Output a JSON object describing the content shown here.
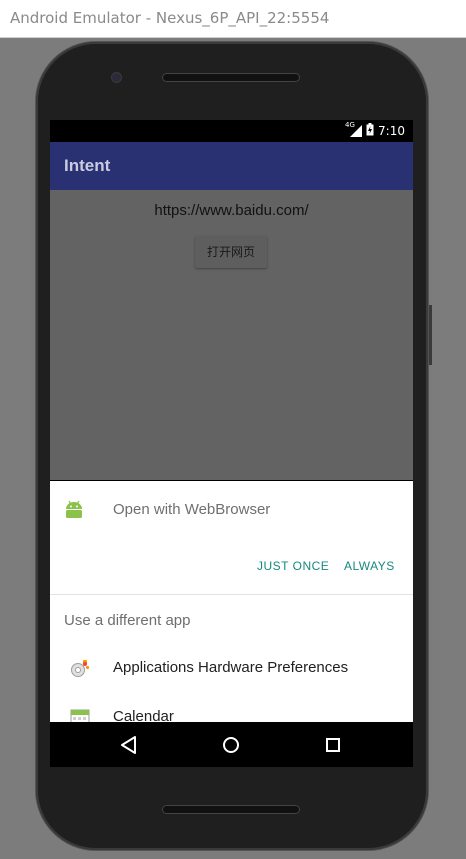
{
  "window": {
    "title": "Android Emulator - Nexus_6P_API_22:5554"
  },
  "status_bar": {
    "network": "4G",
    "time": "7:10"
  },
  "app_bar": {
    "title": "Intent"
  },
  "content": {
    "url": "https://www.baidu.com/",
    "button_label": "打开网页"
  },
  "chooser": {
    "open_with": "Open with WebBrowser",
    "just_once": "JUST ONCE",
    "always": "ALWAYS",
    "different_app": "Use a different app",
    "apps": [
      {
        "label": "Applications Hardware Preferences",
        "icon": "gear-icon"
      },
      {
        "label": "Calendar",
        "icon": "calendar-icon"
      }
    ]
  },
  "colors": {
    "app_bar": "#293173",
    "accent": "#158a7e",
    "scrim": "#636363"
  }
}
